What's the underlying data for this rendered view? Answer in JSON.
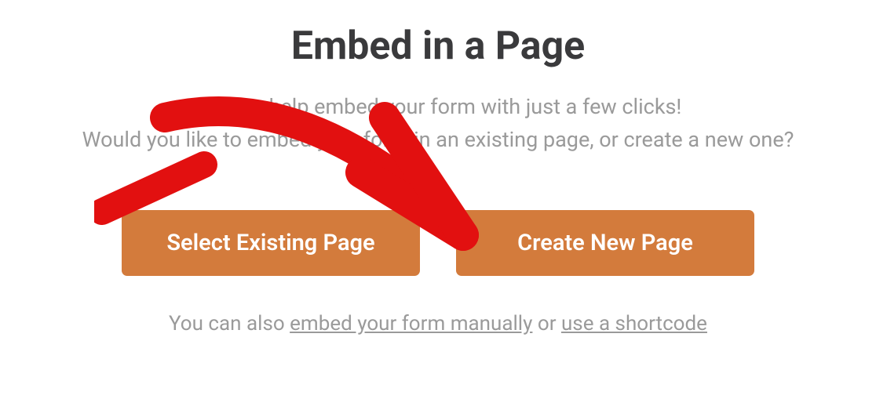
{
  "title": "Embed in a Page",
  "description_line1": "We can help embed your form with just a few clicks!",
  "description_line2": "Would you like to embed your form in an existing page, or create a new one?",
  "buttons": {
    "select_existing": "Select Existing Page",
    "create_new": "Create New Page"
  },
  "footer": {
    "prefix": "You can also ",
    "link1": "embed your form manually",
    "middle": " or ",
    "link2": "use a shortcode"
  }
}
